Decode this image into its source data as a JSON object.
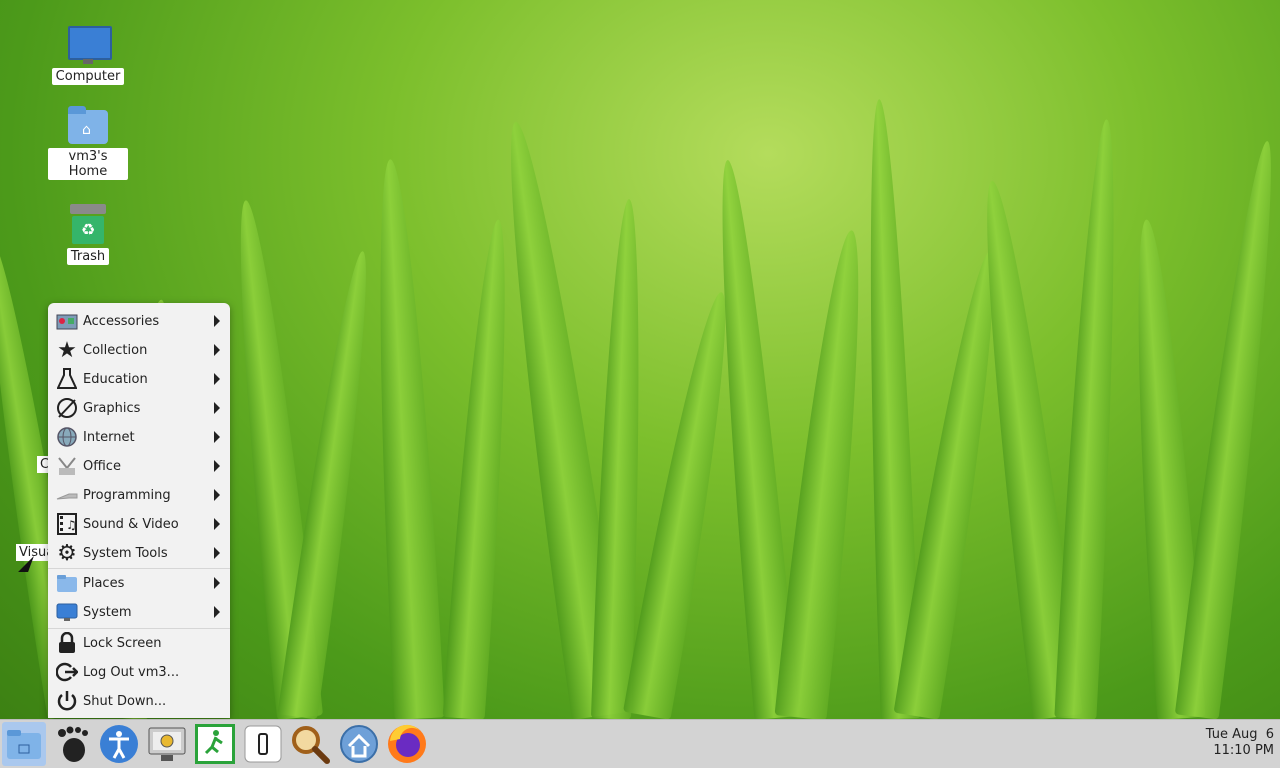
{
  "desktop": {
    "icons": [
      {
        "label": "Computer",
        "icon": "computer-icon"
      },
      {
        "label": "vm3's Home",
        "icon": "home-folder-icon"
      },
      {
        "label": "Trash",
        "icon": "trash-icon"
      }
    ],
    "partial_labels": [
      "C",
      "Visua"
    ]
  },
  "menu": {
    "categories": [
      {
        "label": "Accessories",
        "icon": "accessories-icon"
      },
      {
        "label": "Collection",
        "icon": "star-icon"
      },
      {
        "label": "Education",
        "icon": "flask-icon"
      },
      {
        "label": "Graphics",
        "icon": "palette-icon"
      },
      {
        "label": "Internet",
        "icon": "globe-icon"
      },
      {
        "label": "Office",
        "icon": "office-icon"
      },
      {
        "label": "Programming",
        "icon": "programming-icon"
      },
      {
        "label": "Sound & Video",
        "icon": "film-icon"
      },
      {
        "label": "System Tools",
        "icon": "gear-icon"
      }
    ],
    "places": [
      {
        "label": "Places",
        "icon": "folder-icon"
      },
      {
        "label": "System",
        "icon": "monitor-icon"
      }
    ],
    "actions": [
      {
        "label": "Lock Screen",
        "icon": "lock-icon"
      },
      {
        "label": "Log Out vm3...",
        "icon": "logout-icon"
      },
      {
        "label": "Shut Down...",
        "icon": "power-icon"
      }
    ]
  },
  "taskbar": {
    "launchers": [
      "files-icon",
      "gnome-foot-icon",
      "accessibility-icon",
      "screenshot-icon",
      "exit-icon",
      "phone-icon",
      "magnifier-icon",
      "network-icon",
      "firefox-icon"
    ],
    "clock": {
      "date": "Tue Aug  6",
      "time": "11:10 PM"
    }
  },
  "colors": {
    "accent": "#3a7fd5",
    "menu_bg": "#f2f2f2",
    "taskbar_bg": "#d3d3d3"
  }
}
